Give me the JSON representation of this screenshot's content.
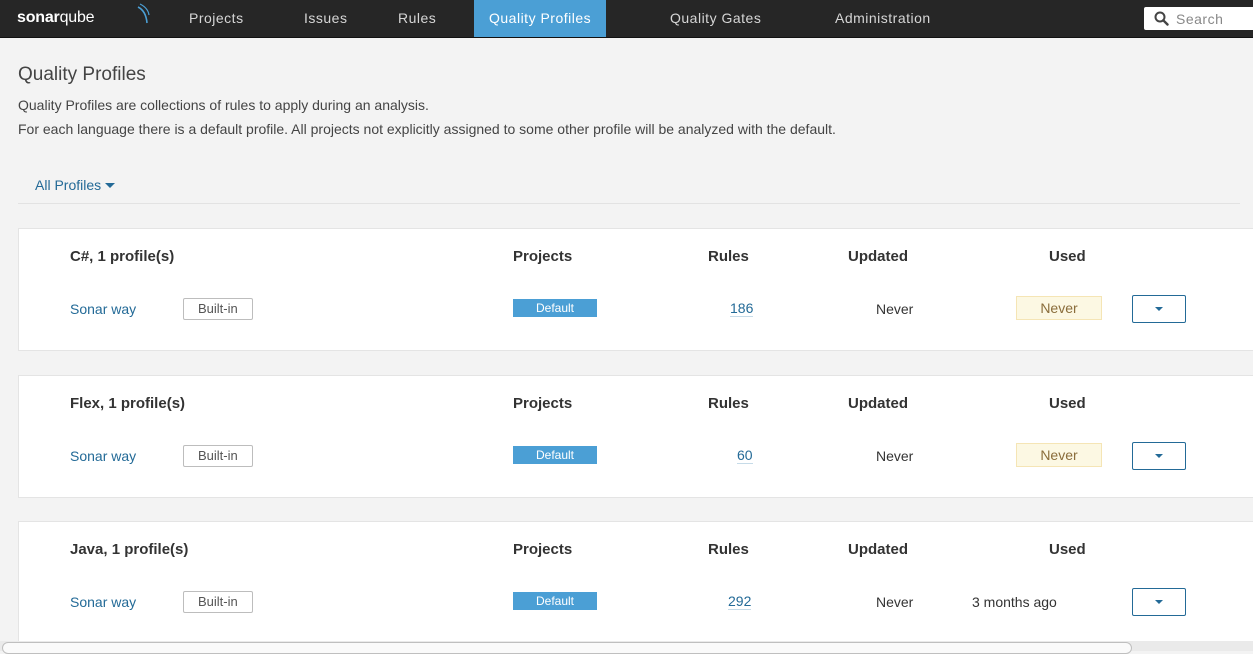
{
  "nav": {
    "logo_bold": "sonar",
    "logo_light": "qube",
    "items": [
      {
        "label": "Projects",
        "active": false
      },
      {
        "label": "Issues",
        "active": false
      },
      {
        "label": "Rules",
        "active": false
      },
      {
        "label": "Quality Profiles",
        "active": true
      },
      {
        "label": "Quality Gates",
        "active": false
      },
      {
        "label": "Administration",
        "active": false
      }
    ],
    "search_placeholder": "Search",
    "search_icon": "search-icon"
  },
  "page": {
    "title": "Quality Profiles",
    "description_line1": "Quality Profiles are collections of rules to apply during an analysis.",
    "description_line2": "For each language there is a default profile. All projects not explicitly assigned to some other profile will be analyzed with the default.",
    "filter_label": "All Profiles"
  },
  "columns": {
    "projects": "Projects",
    "rules": "Rules",
    "updated": "Updated",
    "used": "Used"
  },
  "languages": [
    {
      "heading": "C#, 1 profile(s)",
      "profile": {
        "name": "Sonar way",
        "badge": "Built-in",
        "projects": "Default",
        "rules": "186",
        "updated": "Never",
        "used": "Never",
        "used_highlight": true
      }
    },
    {
      "heading": "Flex, 1 profile(s)",
      "profile": {
        "name": "Sonar way",
        "badge": "Built-in",
        "projects": "Default",
        "rules": "60",
        "updated": "Never",
        "used": "Never",
        "used_highlight": true
      }
    },
    {
      "heading": "Java, 1 profile(s)",
      "profile": {
        "name": "Sonar way",
        "badge": "Built-in",
        "projects": "Default",
        "rules": "292",
        "updated": "Never",
        "used": "3 months ago",
        "used_highlight": false
      }
    }
  ],
  "colors": {
    "nav_bg": "#262626",
    "nav_active": "#4b9fd5",
    "link": "#236a97",
    "warning_bg": "#fcf8e3"
  }
}
